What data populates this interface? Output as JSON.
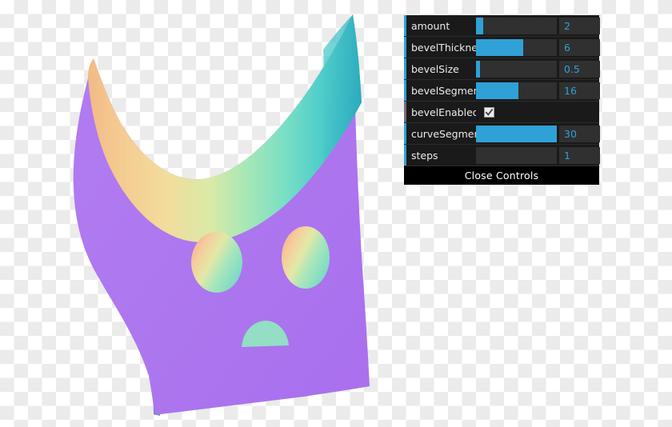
{
  "canvas": {
    "background_pattern": "transparency-checkerboard",
    "checker_light": "#ffffff",
    "checker_dark": "#ebebeb"
  },
  "mesh": {
    "description": "extruded-beveled-3d-face-shape",
    "body_color": "#ad77ef",
    "bevel_gradient": [
      "#f5c08c",
      "#f2d995",
      "#bde8a8",
      "#8ce0c4",
      "#45c4c8",
      "#35b9c4"
    ],
    "eye_gradient": [
      "#f0a48c",
      "#f5d79b",
      "#b5e8b8",
      "#7fdcc4"
    ],
    "mouth_color": "#93dec4",
    "side_face_color": "#2e9cb8"
  },
  "gui": {
    "rows": [
      {
        "label": "amount",
        "type": "slider",
        "value": "2",
        "fill_pct": 9
      },
      {
        "label": "bevelThickness",
        "type": "slider",
        "value": "6",
        "fill_pct": 58
      },
      {
        "label": "bevelSize",
        "type": "slider",
        "value": "0.5",
        "fill_pct": 5
      },
      {
        "label": "bevelSegments",
        "type": "slider",
        "value": "16",
        "fill_pct": 52
      },
      {
        "label": "bevelEnabled",
        "type": "checkbox",
        "value": "true",
        "checked": true
      },
      {
        "label": "curveSegments",
        "type": "slider",
        "value": "30",
        "fill_pct": 100
      },
      {
        "label": "steps",
        "type": "slider",
        "value": "1",
        "fill_pct": 0
      }
    ],
    "close_label": "Close Controls",
    "accent_color": "#2fa1d6",
    "boolean_strip_color": "#806787",
    "panel_background": "#1a1a1a",
    "track_background": "#303030",
    "label_color": "#ebebeb",
    "value_color": "#2fa1d6"
  }
}
